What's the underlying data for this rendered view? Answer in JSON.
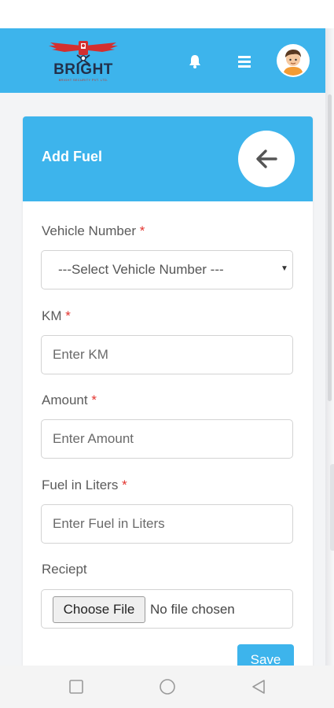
{
  "header": {
    "logo": {
      "name": "BRIGHT",
      "tagline": "BRIGHT SECURITY PVT. LTD."
    },
    "icons": {
      "notification": "bell-icon",
      "menu": "hamburger-menu-icon",
      "profile": "user-avatar"
    }
  },
  "form": {
    "title": "Add Fuel",
    "back_icon": "arrow-left-icon",
    "fields": {
      "vehicle": {
        "label": "Vehicle Number",
        "required_mark": "*",
        "selected": "---Select Vehicle Number ---"
      },
      "km": {
        "label": "KM",
        "required_mark": "*",
        "placeholder": "Enter KM"
      },
      "amount": {
        "label": "Amount",
        "required_mark": "*",
        "placeholder": "Enter Amount"
      },
      "liters": {
        "label": "Fuel in Liters",
        "required_mark": "*",
        "placeholder": "Enter Fuel in Liters"
      },
      "receipt": {
        "label": "Reciept",
        "button": "Choose File",
        "status": "No file chosen"
      }
    },
    "save_label": "Save"
  },
  "system_nav": {
    "recents": "square-icon",
    "home": "circle-icon",
    "back": "triangle-back-icon"
  },
  "colors": {
    "primary": "#3db4ec",
    "required": "#e3342f",
    "background": "#f3f4f6",
    "logo_text": "#23304a",
    "logo_red": "#c0392b"
  }
}
